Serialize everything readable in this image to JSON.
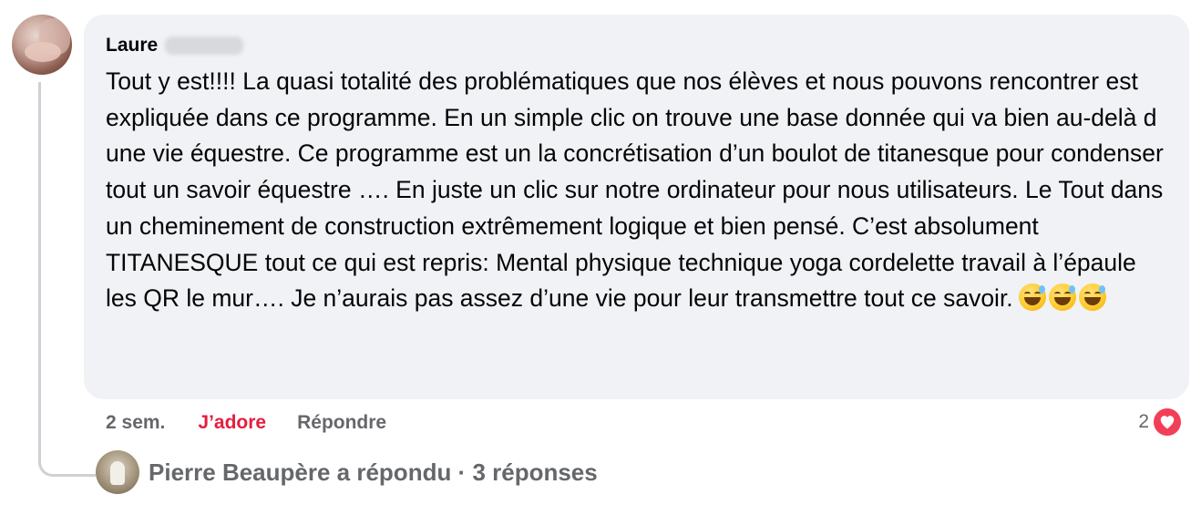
{
  "comment": {
    "author": "Laure",
    "text": "Tout y est!!!! La quasi totalité des problématiques que nos élèves et nous pouvons rencontrer est expliquée dans ce programme. En un simple clic on trouve une base donnée qui va bien au-delà d une vie équestre. Ce programme est un la concrétisation d’un boulot de titanesque pour condenser tout un savoir équestre …. En juste un clic sur notre ordinateur pour nous utilisateurs. Le Tout dans un cheminement de construction extrêmement logique et bien pensé. C’est absolument TITANESQUE tout ce qui est repris: Mental physique technique yoga cordelette travail à l’épaule les QR le mur…. Je n’aurais pas assez d’une vie pour leur transmettre tout ce savoir.",
    "emoji": [
      "grinning-face-with-sweat",
      "grinning-face-with-sweat",
      "grinning-face-with-sweat"
    ]
  },
  "actions": {
    "time": "2 sem.",
    "love_label": "J’adore",
    "reply_label": "Répondre"
  },
  "reactions": {
    "count": "2",
    "type": "heart-icon",
    "color": "#f33e58"
  },
  "replies": {
    "label": "Pierre Beaupère a répondu · 3 réponses"
  },
  "colors": {
    "bubble": "#f0f2f5",
    "secondary_text": "#65676b",
    "love_active": "#e41e3f",
    "thread_line": "#ced0d4"
  }
}
